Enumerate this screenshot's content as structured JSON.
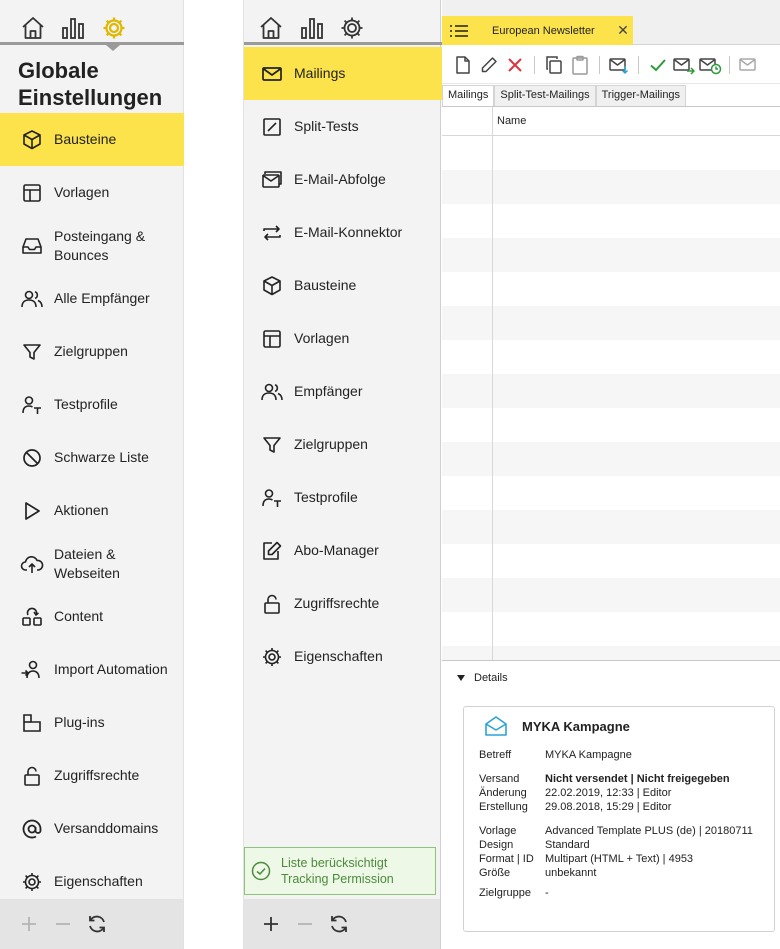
{
  "left": {
    "title_line1": "Globale",
    "title_line2": "Einstellungen",
    "items": [
      {
        "label": "Bausteine",
        "icon": "cube-icon",
        "active": true
      },
      {
        "label": "Vorlagen",
        "icon": "template-icon"
      },
      {
        "label": "Posteingang &\nBounces",
        "icon": "inbox-icon"
      },
      {
        "label": "Alle Empfänger",
        "icon": "users-icon"
      },
      {
        "label": "Zielgruppen",
        "icon": "funnel-icon"
      },
      {
        "label": "Testprofile",
        "icon": "test-profile-icon"
      },
      {
        "label": "Schwarze Liste",
        "icon": "blocked-icon"
      },
      {
        "label": "Aktionen",
        "icon": "play-icon"
      },
      {
        "label": "Dateien &\nWebseiten",
        "icon": "cloud-upload-icon"
      },
      {
        "label": "Content",
        "icon": "content-icon"
      },
      {
        "label": "Import Automation",
        "icon": "import-user-icon"
      },
      {
        "label": "Plug-ins",
        "icon": "plugin-icon"
      },
      {
        "label": "Zugriffsrechte",
        "icon": "lock-icon"
      },
      {
        "label": "Versanddomains",
        "icon": "at-icon"
      },
      {
        "label": "Eigenschaften",
        "icon": "gear-icon"
      }
    ]
  },
  "middle": {
    "items": [
      {
        "label": "Mailings",
        "icon": "envelope-icon",
        "active": true
      },
      {
        "label": "Split-Tests",
        "icon": "split-icon"
      },
      {
        "label": "E-Mail-Abfolge",
        "icon": "email-sequence-icon"
      },
      {
        "label": "E-Mail-Konnektor",
        "icon": "connector-icon"
      },
      {
        "label": "Bausteine",
        "icon": "cube-icon"
      },
      {
        "label": "Vorlagen",
        "icon": "template-icon"
      },
      {
        "label": "Empfänger",
        "icon": "users-icon"
      },
      {
        "label": "Zielgruppen",
        "icon": "funnel-icon"
      },
      {
        "label": "Testprofile",
        "icon": "test-profile-icon"
      },
      {
        "label": "Abo-Manager",
        "icon": "edit-icon"
      },
      {
        "label": "Zugriffsrechte",
        "icon": "lock-icon"
      },
      {
        "label": "Eigenschaften",
        "icon": "gear-icon"
      }
    ],
    "status_line1": "Liste berücksichtigt",
    "status_line2": "Tracking Permission"
  },
  "right": {
    "tab_title": "European Newsletter",
    "tab_close": "✕",
    "subtabs": [
      "Mailings",
      "Split-Test-Mailings",
      "Trigger-Mailings"
    ],
    "column_name": "Name",
    "details_label": "Details",
    "card": {
      "title": "MYKA Kampagne",
      "betreff_k": "Betreff",
      "betreff_v": "MYKA Kampagne",
      "versand_k": "Versand",
      "versand_v": "Nicht versendet | Nicht freigegeben",
      "aenderung_k": "Änderung",
      "aenderung_v": "22.02.2019, 12:33 | Editor",
      "erstellung_k": "Erstellung",
      "erstellung_v": "29.08.2018, 15:29 | Editor",
      "vorlage_k": "Vorlage",
      "vorlage_v": "Advanced Template PLUS (de) | 20180711",
      "design_k": "Design",
      "design_v": "Standard",
      "format_k": "Format | ID",
      "format_v": "Multipart (HTML + Text) | 4953",
      "groesse_k": "Größe",
      "groesse_v": "unbekannt",
      "zielgruppe_k": "Zielgruppe",
      "zielgruppe_v": "-"
    }
  },
  "colors": {
    "accent": "#fce34b",
    "gear_active": "#e0b800",
    "status_green": "#4d8a3c",
    "delete_red": "#d9363e",
    "check_green": "#2f9a3a",
    "mail_blue": "#2ba3d6"
  }
}
